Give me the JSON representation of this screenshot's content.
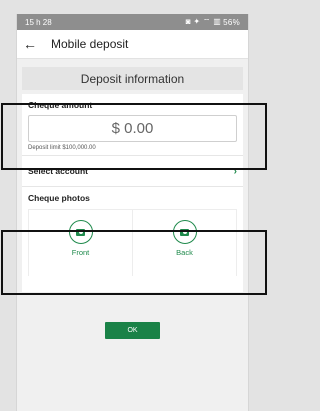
{
  "status_bar": {
    "time": "15 h 28",
    "icons_text": "◙ ✦ ⌔ ▥",
    "battery": "56%"
  },
  "header": {
    "back_symbol": "←",
    "title": "Mobile deposit"
  },
  "section": {
    "title": "Deposit information"
  },
  "cheque_amount": {
    "label": "Cheque amount",
    "value": "$ 0.00",
    "limit": "Deposit limit $100,000.00"
  },
  "account": {
    "label": "Select account",
    "chevron": "›"
  },
  "photos": {
    "label": "Cheque photos",
    "front": "Front",
    "back": "Back"
  },
  "actions": {
    "ok": "OK"
  },
  "colors": {
    "accent": "#1f8a4c",
    "button": "#1a8247"
  }
}
